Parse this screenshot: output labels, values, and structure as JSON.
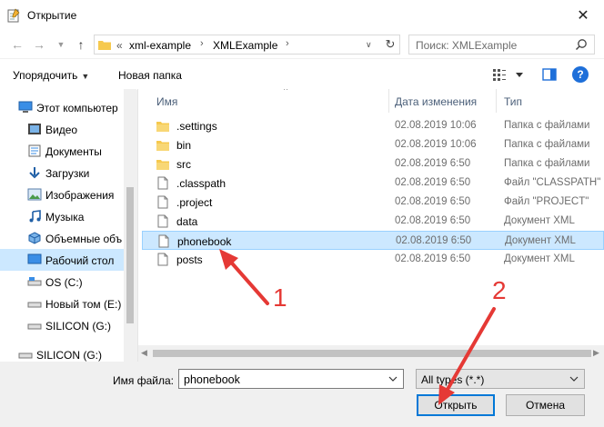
{
  "window": {
    "title": "Открытие"
  },
  "nav": {
    "path_prefix": "«",
    "breadcrumbs": [
      "xml-example",
      "XMLExample"
    ],
    "search_placeholder": "Поиск: XMLExample"
  },
  "toolbar": {
    "organize_label": "Упорядочить",
    "new_folder_label": "Новая папка"
  },
  "sidebar": {
    "items": [
      {
        "label": "Этот компьютер",
        "icon": "computer-icon"
      },
      {
        "label": "Видео",
        "icon": "video-folder-icon"
      },
      {
        "label": "Документы",
        "icon": "documents-folder-icon"
      },
      {
        "label": "Загрузки",
        "icon": "downloads-folder-icon"
      },
      {
        "label": "Изображения",
        "icon": "pictures-folder-icon"
      },
      {
        "label": "Музыка",
        "icon": "music-folder-icon"
      },
      {
        "label": "Объемные объ",
        "icon": "3d-objects-folder-icon"
      },
      {
        "label": "Рабочий стол",
        "icon": "desktop-folder-icon"
      },
      {
        "label": "OS (C:)",
        "icon": "drive-icon"
      },
      {
        "label": "Новый том (E:)",
        "icon": "drive-icon"
      },
      {
        "label": "SILICON (G:)",
        "icon": "drive-icon"
      },
      {
        "label": "SILICON (G:)",
        "icon": "usb-drive-icon"
      }
    ]
  },
  "columns": {
    "name": "Имя",
    "date": "Дата изменения",
    "type": "Тип"
  },
  "files": [
    {
      "name": ".settings",
      "date": "02.08.2019 10:06",
      "type": "Папка с файлами",
      "kind": "folder"
    },
    {
      "name": "bin",
      "date": "02.08.2019 10:06",
      "type": "Папка с файлами",
      "kind": "folder"
    },
    {
      "name": "src",
      "date": "02.08.2019 6:50",
      "type": "Папка с файлами",
      "kind": "folder"
    },
    {
      "name": ".classpath",
      "date": "02.08.2019 6:50",
      "type": "Файл \"CLASSPATH\"",
      "kind": "file"
    },
    {
      "name": ".project",
      "date": "02.08.2019 6:50",
      "type": "Файл \"PROJECT\"",
      "kind": "file"
    },
    {
      "name": "data",
      "date": "02.08.2019 6:50",
      "type": "Документ XML",
      "kind": "file"
    },
    {
      "name": "phonebook",
      "date": "02.08.2019 6:50",
      "type": "Документ XML",
      "kind": "file",
      "selected": true
    },
    {
      "name": "posts",
      "date": "02.08.2019 6:50",
      "type": "Документ XML",
      "kind": "file"
    }
  ],
  "bottom": {
    "filename_label": "Имя файла:",
    "filename_value": "phonebook",
    "filetype_value": "All types (*.*)",
    "open_label": "Открыть",
    "cancel_label": "Отмена"
  },
  "annotations": {
    "marker_1": "1",
    "marker_2": "2",
    "color": "#e53935"
  },
  "colors": {
    "selection": "#cce8ff",
    "accent": "#0078d7",
    "folder": "#f6c94e"
  }
}
